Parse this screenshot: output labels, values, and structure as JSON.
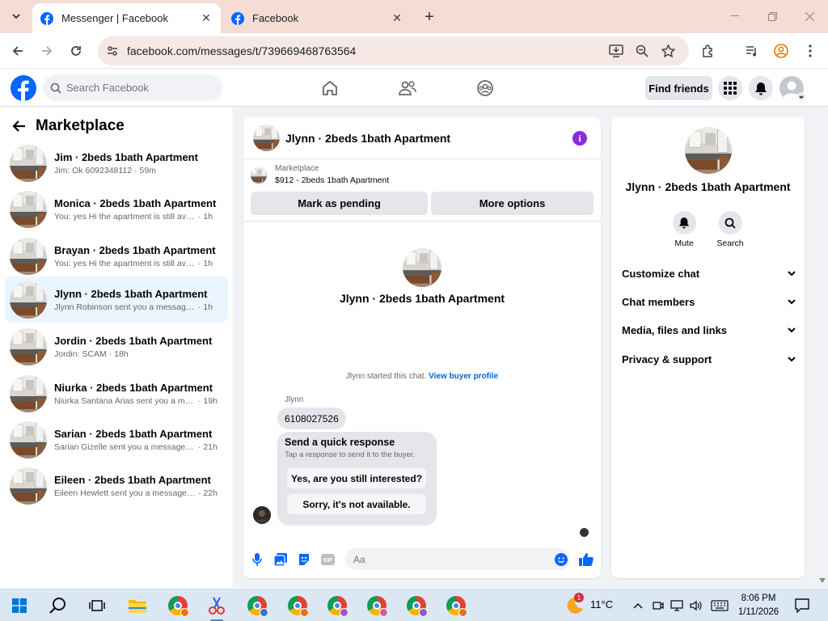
{
  "browser": {
    "tabs": [
      {
        "title": "Messenger | Facebook",
        "active": true
      },
      {
        "title": "Facebook",
        "active": false
      }
    ],
    "url": "facebook.com/messages/t/739669468763564"
  },
  "header": {
    "search_placeholder": "Search Facebook",
    "find_friends": "Find friends"
  },
  "sidebar": {
    "title": "Marketplace",
    "conversations": [
      {
        "name": "Jim · 2beds 1bath Apartment",
        "preview": "Jim: Ok 6092348112",
        "time": "· 59m",
        "selected": false
      },
      {
        "name": "Monica · 2beds 1bath Apartment",
        "preview": "You: yes Hi the apartment is still availa...",
        "time": "· 1h",
        "selected": false
      },
      {
        "name": "Brayan · 2beds 1bath Apartment",
        "preview": "You: yes Hi the apartment is still availa...",
        "time": "· 1h",
        "selected": false
      },
      {
        "name": "Jlynn · 2beds 1bath Apartment",
        "preview": "Jlynn Robinson sent you a message a...",
        "time": "· 1h",
        "selected": true
      },
      {
        "name": "Jordin · 2beds 1bath Apartment",
        "preview": "Jordin: SCAM",
        "time": "· 18h",
        "selected": false
      },
      {
        "name": "Niurka · 2beds 1bath Apartment",
        "preview": "Niurka Santana Arias sent you a mes...",
        "time": "· 19h",
        "selected": false
      },
      {
        "name": "Sarian · 2beds 1bath Apartment",
        "preview": "Sarian Gizelle sent you a message ab...",
        "time": "· 21h",
        "selected": false
      },
      {
        "name": "Eileen · 2beds 1bath Apartment",
        "preview": "Eileen Hewlett sent you a message a...",
        "time": "· 22h",
        "selected": false
      }
    ]
  },
  "chat": {
    "title": "Jlynn · 2beds 1bath Apartment",
    "marketplace_label": "Marketplace",
    "listing": "$912 - 2beds 1bath Apartment",
    "mark_pending": "Mark as pending",
    "more_options": "More options",
    "profile_name": "Jlynn · 2beds 1bath Apartment",
    "started_text": "Jlynn started this chat.",
    "view_profile": "View buyer profile",
    "sender": "Jlynn",
    "message": "6108027526",
    "quick_title": "Send a quick response",
    "quick_sub": "Tap a response to send it to the buyer.",
    "quick_replies": [
      "Yes, are you still interested?",
      "Sorry, it's not available."
    ],
    "compose_placeholder": "Aa"
  },
  "details": {
    "name": "Jlynn · 2beds 1bath Apartment",
    "mute": "Mute",
    "search": "Search",
    "sections": [
      "Customize chat",
      "Chat members",
      "Media, files and links",
      "Privacy & support"
    ]
  },
  "taskbar": {
    "temperature": "11°C",
    "time": "8:06 PM",
    "date": "1/11/2026",
    "weather_badge": "1"
  },
  "colors": {
    "fb_blue": "#0866ff",
    "selected_bg": "#ebf5ff",
    "info_purple": "#8a2be2",
    "link_blue": "#0064d1"
  }
}
